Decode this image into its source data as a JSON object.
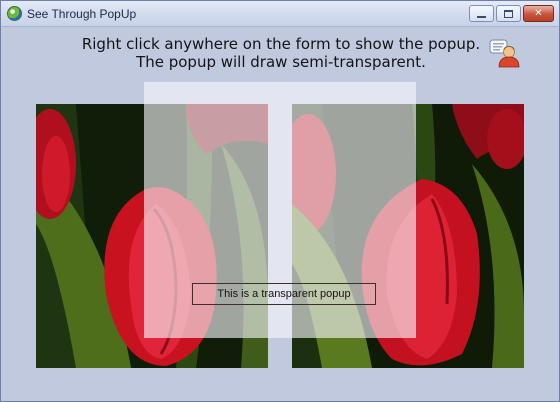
{
  "window": {
    "title": "See Through PopUp",
    "app_icon": "app-globe-icon",
    "controls": {
      "minimize_icon": "minimize-icon",
      "maximize_icon": "maximize-icon",
      "close_glyph": "✕"
    }
  },
  "instructions": {
    "line1": "Right click anywhere on the form to show the popup.",
    "line2": "The popup will draw semi-transparent."
  },
  "user_icon": "user-info-icon",
  "images": {
    "left": "tulip-photo",
    "right": "tulip-photo"
  },
  "popup": {
    "label": "This is a transparent popup"
  },
  "colors": {
    "form_background": "#c1c9df",
    "close_button": "#c8533d",
    "tulip_red": "#d4152a",
    "leaf_green": "#4e6e1c"
  }
}
